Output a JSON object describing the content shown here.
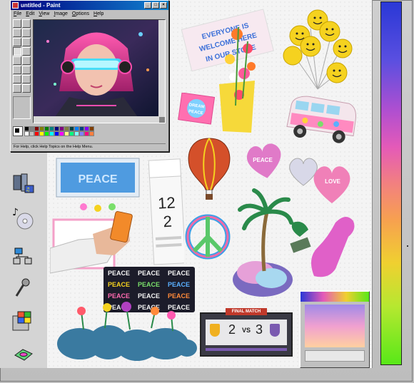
{
  "paint": {
    "title": "untitled - Paint",
    "menu": [
      "File",
      "Edit",
      "View",
      "Image",
      "Options",
      "Help"
    ],
    "status": "For Help, click Help Topics on the Help Menu."
  },
  "stickers": {
    "placard": "EVERYONE IS WELCOME HERE IN OUR STORE",
    "dream_peace": "DREAM PEACE",
    "peace_screen": "PEACE",
    "calendar_month": "12 月",
    "calendar_day": "2 日",
    "scoreboard": {
      "header": "FINAL MATCH",
      "left": "2",
      "vs": "VS",
      "right": "3"
    },
    "peace_sign_words": [
      "PEACE",
      "PEACE",
      "PEACE",
      "PEACE",
      "PEACE",
      "PEACE",
      "PEACE",
      "PEACE",
      "PEACE",
      "PEACE",
      "PEACE",
      "PEACE"
    ],
    "heart_love": "LOVE",
    "heart_peace": "PEACE"
  },
  "rail_icons": [
    "media-player-icon",
    "music-cd-icon",
    "network-icon",
    "microphone-icon",
    "windows-setup-icon",
    "disk-icon"
  ],
  "colors": {
    "titlebar_start": "#000080",
    "titlebar_end": "#1084d0",
    "window_gray": "#c0c0c0"
  }
}
